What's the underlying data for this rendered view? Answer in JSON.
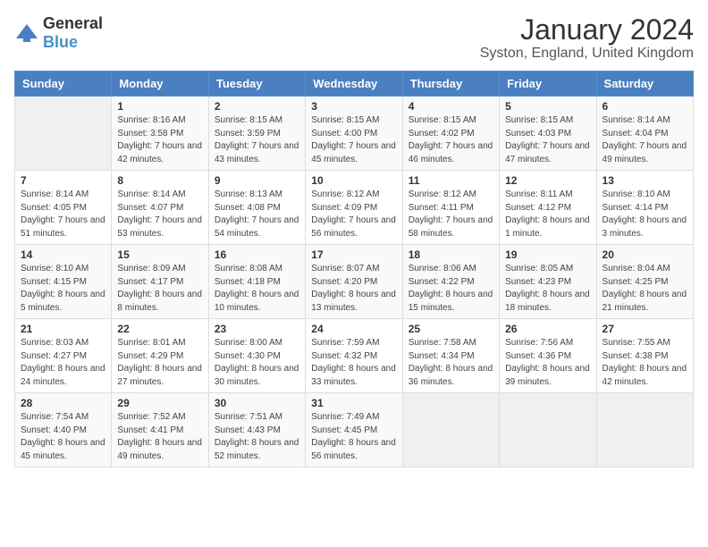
{
  "header": {
    "logo_general": "General",
    "logo_blue": "Blue",
    "main_title": "January 2024",
    "subtitle": "Syston, England, United Kingdom"
  },
  "calendar": {
    "weekdays": [
      "Sunday",
      "Monday",
      "Tuesday",
      "Wednesday",
      "Thursday",
      "Friday",
      "Saturday"
    ],
    "weeks": [
      [
        {
          "day": "",
          "sunrise": "",
          "sunset": "",
          "daylight": "",
          "empty": true
        },
        {
          "day": "1",
          "sunrise": "Sunrise: 8:16 AM",
          "sunset": "Sunset: 3:58 PM",
          "daylight": "Daylight: 7 hours and 42 minutes.",
          "empty": false
        },
        {
          "day": "2",
          "sunrise": "Sunrise: 8:15 AM",
          "sunset": "Sunset: 3:59 PM",
          "daylight": "Daylight: 7 hours and 43 minutes.",
          "empty": false
        },
        {
          "day": "3",
          "sunrise": "Sunrise: 8:15 AM",
          "sunset": "Sunset: 4:00 PM",
          "daylight": "Daylight: 7 hours and 45 minutes.",
          "empty": false
        },
        {
          "day": "4",
          "sunrise": "Sunrise: 8:15 AM",
          "sunset": "Sunset: 4:02 PM",
          "daylight": "Daylight: 7 hours and 46 minutes.",
          "empty": false
        },
        {
          "day": "5",
          "sunrise": "Sunrise: 8:15 AM",
          "sunset": "Sunset: 4:03 PM",
          "daylight": "Daylight: 7 hours and 47 minutes.",
          "empty": false
        },
        {
          "day": "6",
          "sunrise": "Sunrise: 8:14 AM",
          "sunset": "Sunset: 4:04 PM",
          "daylight": "Daylight: 7 hours and 49 minutes.",
          "empty": false
        }
      ],
      [
        {
          "day": "7",
          "sunrise": "Sunrise: 8:14 AM",
          "sunset": "Sunset: 4:05 PM",
          "daylight": "Daylight: 7 hours and 51 minutes.",
          "empty": false
        },
        {
          "day": "8",
          "sunrise": "Sunrise: 8:14 AM",
          "sunset": "Sunset: 4:07 PM",
          "daylight": "Daylight: 7 hours and 53 minutes.",
          "empty": false
        },
        {
          "day": "9",
          "sunrise": "Sunrise: 8:13 AM",
          "sunset": "Sunset: 4:08 PM",
          "daylight": "Daylight: 7 hours and 54 minutes.",
          "empty": false
        },
        {
          "day": "10",
          "sunrise": "Sunrise: 8:12 AM",
          "sunset": "Sunset: 4:09 PM",
          "daylight": "Daylight: 7 hours and 56 minutes.",
          "empty": false
        },
        {
          "day": "11",
          "sunrise": "Sunrise: 8:12 AM",
          "sunset": "Sunset: 4:11 PM",
          "daylight": "Daylight: 7 hours and 58 minutes.",
          "empty": false
        },
        {
          "day": "12",
          "sunrise": "Sunrise: 8:11 AM",
          "sunset": "Sunset: 4:12 PM",
          "daylight": "Daylight: 8 hours and 1 minute.",
          "empty": false
        },
        {
          "day": "13",
          "sunrise": "Sunrise: 8:10 AM",
          "sunset": "Sunset: 4:14 PM",
          "daylight": "Daylight: 8 hours and 3 minutes.",
          "empty": false
        }
      ],
      [
        {
          "day": "14",
          "sunrise": "Sunrise: 8:10 AM",
          "sunset": "Sunset: 4:15 PM",
          "daylight": "Daylight: 8 hours and 5 minutes.",
          "empty": false
        },
        {
          "day": "15",
          "sunrise": "Sunrise: 8:09 AM",
          "sunset": "Sunset: 4:17 PM",
          "daylight": "Daylight: 8 hours and 8 minutes.",
          "empty": false
        },
        {
          "day": "16",
          "sunrise": "Sunrise: 8:08 AM",
          "sunset": "Sunset: 4:18 PM",
          "daylight": "Daylight: 8 hours and 10 minutes.",
          "empty": false
        },
        {
          "day": "17",
          "sunrise": "Sunrise: 8:07 AM",
          "sunset": "Sunset: 4:20 PM",
          "daylight": "Daylight: 8 hours and 13 minutes.",
          "empty": false
        },
        {
          "day": "18",
          "sunrise": "Sunrise: 8:06 AM",
          "sunset": "Sunset: 4:22 PM",
          "daylight": "Daylight: 8 hours and 15 minutes.",
          "empty": false
        },
        {
          "day": "19",
          "sunrise": "Sunrise: 8:05 AM",
          "sunset": "Sunset: 4:23 PM",
          "daylight": "Daylight: 8 hours and 18 minutes.",
          "empty": false
        },
        {
          "day": "20",
          "sunrise": "Sunrise: 8:04 AM",
          "sunset": "Sunset: 4:25 PM",
          "daylight": "Daylight: 8 hours and 21 minutes.",
          "empty": false
        }
      ],
      [
        {
          "day": "21",
          "sunrise": "Sunrise: 8:03 AM",
          "sunset": "Sunset: 4:27 PM",
          "daylight": "Daylight: 8 hours and 24 minutes.",
          "empty": false
        },
        {
          "day": "22",
          "sunrise": "Sunrise: 8:01 AM",
          "sunset": "Sunset: 4:29 PM",
          "daylight": "Daylight: 8 hours and 27 minutes.",
          "empty": false
        },
        {
          "day": "23",
          "sunrise": "Sunrise: 8:00 AM",
          "sunset": "Sunset: 4:30 PM",
          "daylight": "Daylight: 8 hours and 30 minutes.",
          "empty": false
        },
        {
          "day": "24",
          "sunrise": "Sunrise: 7:59 AM",
          "sunset": "Sunset: 4:32 PM",
          "daylight": "Daylight: 8 hours and 33 minutes.",
          "empty": false
        },
        {
          "day": "25",
          "sunrise": "Sunrise: 7:58 AM",
          "sunset": "Sunset: 4:34 PM",
          "daylight": "Daylight: 8 hours and 36 minutes.",
          "empty": false
        },
        {
          "day": "26",
          "sunrise": "Sunrise: 7:56 AM",
          "sunset": "Sunset: 4:36 PM",
          "daylight": "Daylight: 8 hours and 39 minutes.",
          "empty": false
        },
        {
          "day": "27",
          "sunrise": "Sunrise: 7:55 AM",
          "sunset": "Sunset: 4:38 PM",
          "daylight": "Daylight: 8 hours and 42 minutes.",
          "empty": false
        }
      ],
      [
        {
          "day": "28",
          "sunrise": "Sunrise: 7:54 AM",
          "sunset": "Sunset: 4:40 PM",
          "daylight": "Daylight: 8 hours and 45 minutes.",
          "empty": false
        },
        {
          "day": "29",
          "sunrise": "Sunrise: 7:52 AM",
          "sunset": "Sunset: 4:41 PM",
          "daylight": "Daylight: 8 hours and 49 minutes.",
          "empty": false
        },
        {
          "day": "30",
          "sunrise": "Sunrise: 7:51 AM",
          "sunset": "Sunset: 4:43 PM",
          "daylight": "Daylight: 8 hours and 52 minutes.",
          "empty": false
        },
        {
          "day": "31",
          "sunrise": "Sunrise: 7:49 AM",
          "sunset": "Sunset: 4:45 PM",
          "daylight": "Daylight: 8 hours and 56 minutes.",
          "empty": false
        },
        {
          "day": "",
          "sunrise": "",
          "sunset": "",
          "daylight": "",
          "empty": true
        },
        {
          "day": "",
          "sunrise": "",
          "sunset": "",
          "daylight": "",
          "empty": true
        },
        {
          "day": "",
          "sunrise": "",
          "sunset": "",
          "daylight": "",
          "empty": true
        }
      ]
    ]
  }
}
